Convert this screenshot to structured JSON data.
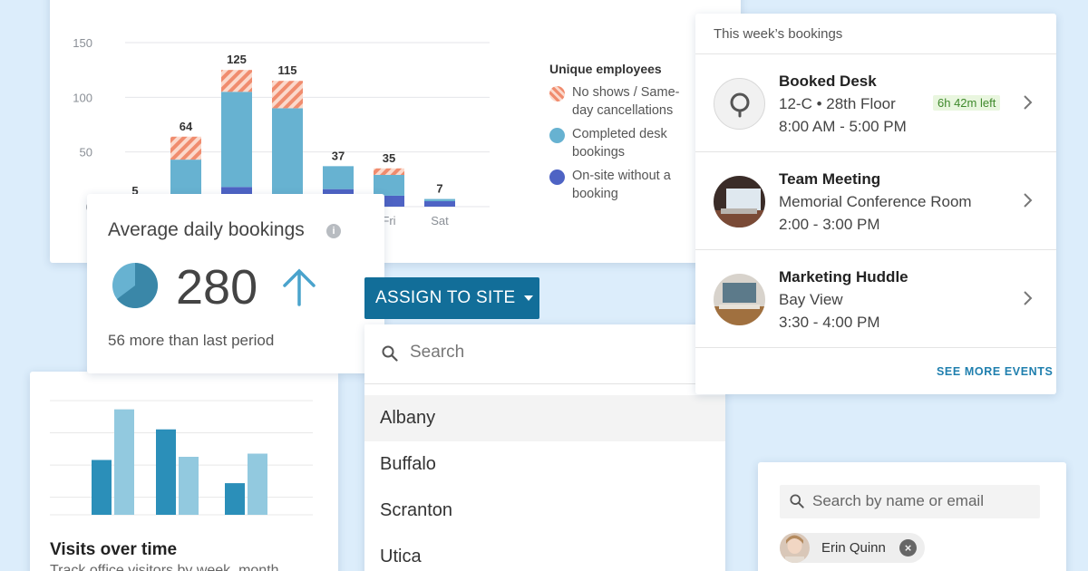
{
  "booking_chart": {
    "legend_title": "Unique employees",
    "legend": [
      {
        "label": "No shows / Same-day cancellations",
        "color": "#f08c6e",
        "pattern": "stripes"
      },
      {
        "label": "Completed desk bookings",
        "color": "#67b2d1"
      },
      {
        "label": "On-site without a booking",
        "color": "#4e63c4"
      }
    ]
  },
  "chart_data": [
    {
      "type": "bar",
      "stacked": true,
      "categories": [
        "",
        "",
        "",
        "",
        "",
        "Fri",
        "Sat"
      ],
      "yticks": [
        0,
        50,
        100,
        150
      ],
      "ylim": [
        0,
        150
      ],
      "totals": [
        5,
        64,
        125,
        115,
        37,
        35,
        7
      ],
      "series": [
        {
          "name": "On-site without a booking",
          "color": "#4e63c4",
          "values": [
            0,
            5,
            18,
            5,
            16,
            10,
            5
          ]
        },
        {
          "name": "Completed desk bookings",
          "color": "#67b2d1",
          "values": [
            5,
            38,
            87,
            85,
            21,
            19,
            2
          ]
        },
        {
          "name": "No shows / Same-day cancellations",
          "color": "#f08c6e",
          "values": [
            0,
            21,
            20,
            25,
            0,
            6,
            0
          ]
        }
      ],
      "grid": true
    },
    {
      "type": "bar",
      "categories": [
        "",
        "",
        ""
      ],
      "series": [
        {
          "values": [
            52,
            81,
            30
          ],
          "color": "#2b8fb9"
        },
        {
          "values": [
            100,
            55,
            58
          ],
          "color": "#92c9df"
        }
      ],
      "ylim": [
        0,
        110
      ],
      "grid": true
    }
  ],
  "avg": {
    "title": "Average daily bookings",
    "info_icon": "i",
    "value": "280",
    "subtitle": "56 more than last period",
    "pie_color_dark": "#3a87a8",
    "pie_color_light": "#67b2d1"
  },
  "assign": {
    "button_label": "ASSIGN TO SITE",
    "search_placeholder": "Search",
    "sites": [
      "Albany",
      "Buffalo",
      "Scranton",
      "Utica"
    ]
  },
  "visits": {
    "title": "Visits over time",
    "subtitle": "Track office visitors by week, month"
  },
  "week": {
    "header": "This week’s bookings",
    "events": [
      {
        "title": "Booked Desk",
        "line1": "12-C • 28th Floor",
        "line2": "8:00 AM - 5:00 PM",
        "badge": "6h 42m left"
      },
      {
        "title": "Team Meeting",
        "line1": "Memorial Conference Room",
        "line2": "2:00 - 3:00 PM"
      },
      {
        "title": "Marketing Huddle",
        "line1": "Bay View",
        "line2": "3:30 - 4:00 PM"
      }
    ],
    "see_more": "SEE MORE EVENTS"
  },
  "people": {
    "search_placeholder": "Search by name or email",
    "chip_name": "Erin Quinn"
  }
}
